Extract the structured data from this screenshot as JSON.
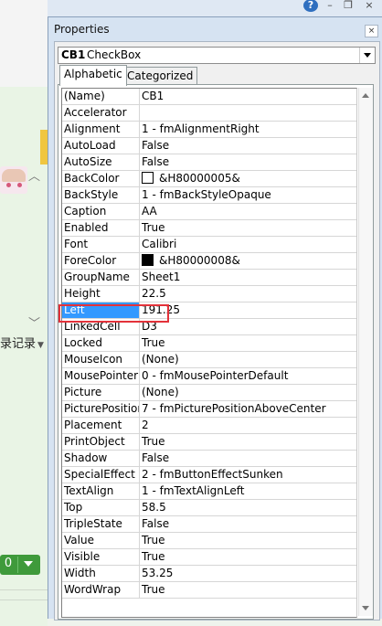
{
  "window": {
    "title": "Properties",
    "close_glyph": "×"
  },
  "object_selector": {
    "name": "CB1",
    "type": "CheckBox"
  },
  "tabs": [
    {
      "label": "Alphabetic",
      "active": true
    },
    {
      "label": "Categorized",
      "active": false
    }
  ],
  "properties": [
    {
      "name": "(Name)",
      "value": "CB1"
    },
    {
      "name": "Accelerator",
      "value": ""
    },
    {
      "name": "Alignment",
      "value": "1 - fmAlignmentRight"
    },
    {
      "name": "AutoLoad",
      "value": "False"
    },
    {
      "name": "AutoSize",
      "value": "False"
    },
    {
      "name": "BackColor",
      "value": "&H80000005&",
      "swatch": "#ffffff"
    },
    {
      "name": "BackStyle",
      "value": "1 - fmBackStyleOpaque"
    },
    {
      "name": "Caption",
      "value": "AA"
    },
    {
      "name": "Enabled",
      "value": "True"
    },
    {
      "name": "Font",
      "value": "Calibri"
    },
    {
      "name": "ForeColor",
      "value": "&H80000008&",
      "swatch": "#000000"
    },
    {
      "name": "GroupName",
      "value": "Sheet1"
    },
    {
      "name": "Height",
      "value": "22.5"
    },
    {
      "name": "Left",
      "value": "191.25",
      "selected": true
    },
    {
      "name": "LinkedCell",
      "value": "D3",
      "highlighted": true
    },
    {
      "name": "Locked",
      "value": "True"
    },
    {
      "name": "MouseIcon",
      "value": "(None)"
    },
    {
      "name": "MousePointer",
      "value": "0 - fmMousePointerDefault"
    },
    {
      "name": "Picture",
      "value": "(None)"
    },
    {
      "name": "PicturePosition",
      "value": "7 - fmPicturePositionAboveCenter"
    },
    {
      "name": "Placement",
      "value": "2"
    },
    {
      "name": "PrintObject",
      "value": "True"
    },
    {
      "name": "Shadow",
      "value": "False"
    },
    {
      "name": "SpecialEffect",
      "value": "2 - fmButtonEffectSunken"
    },
    {
      "name": "TextAlign",
      "value": "1 - fmTextAlignLeft"
    },
    {
      "name": "Top",
      "value": "58.5"
    },
    {
      "name": "TripleState",
      "value": "False"
    },
    {
      "name": "Value",
      "value": "True"
    },
    {
      "name": "Visible",
      "value": "True"
    },
    {
      "name": "Width",
      "value": "53.25"
    },
    {
      "name": "WordWrap",
      "value": "True"
    }
  ],
  "background_app": {
    "side_text": "录记录",
    "side_button_label": "0",
    "help_glyph": "?",
    "minimize_glyph": "–",
    "restore_glyph": "❐",
    "close_glyph": "×"
  },
  "colors": {
    "selection": "#3399ff",
    "highlight_box": "#e3323a",
    "window_frame": "#d6e3f2",
    "app_green": "#3f9a3b"
  }
}
